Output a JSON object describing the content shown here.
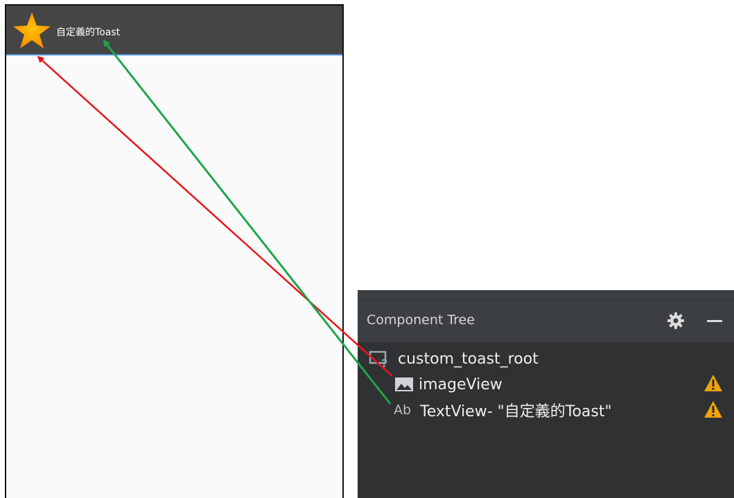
{
  "device": {
    "toast_text": "自定義的Toast",
    "toast_bar_color": "#454545",
    "toast_icon": "star-icon",
    "star_color": "#ffa000"
  },
  "component_tree": {
    "title": "Component Tree",
    "settings_icon": "gear-icon",
    "minimize_icon": "minimize-icon",
    "nodes": [
      {
        "icon": "layout-unknown-icon",
        "label": "custom_toast_root",
        "warning": false
      },
      {
        "icon": "image-icon",
        "label": "imageView",
        "warning": true
      },
      {
        "icon": "text-ab-icon",
        "prefix": "Ab",
        "label": "TextView- \"自定義的Toast\"",
        "warning": true
      }
    ],
    "warning_icon": "warning-icon",
    "warning_color": "#f0a30a"
  },
  "annotations": [
    {
      "from": "imageView",
      "to": "star-icon",
      "color": "#e8141b"
    },
    {
      "from": "TextView",
      "to": "toast-text",
      "color": "#1fa64a"
    }
  ]
}
